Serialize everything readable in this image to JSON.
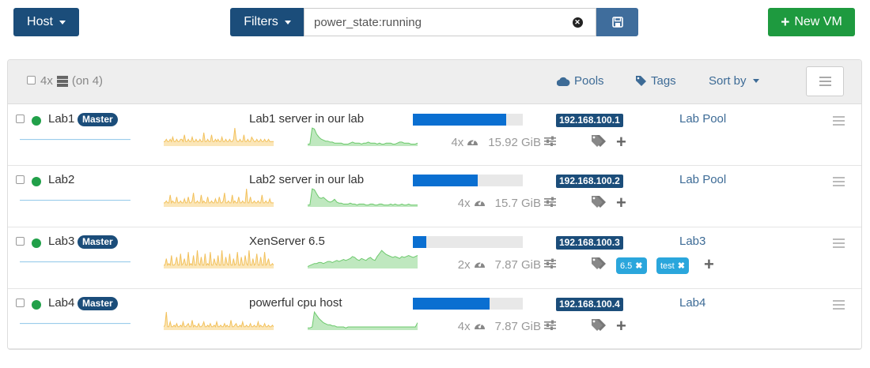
{
  "toolbar": {
    "host_label": "Host",
    "filters_label": "Filters",
    "filter_value": "power_state:running",
    "new_vm_label": "New VM"
  },
  "panel": {
    "count_label": "4x",
    "on_label": "(on 4)",
    "pools_label": "Pools",
    "tags_label": "Tags",
    "sort_label": "Sort by"
  },
  "colors": {
    "primary": "#1b4d7a",
    "success": "#1e9a3f",
    "running": "#21a049",
    "link": "#3d6b96",
    "tag": "#2aa6dc"
  },
  "hosts": [
    {
      "name": "Lab1",
      "master": "Master",
      "description": "Lab1 server in our lab",
      "usage": 0.85,
      "ip": "192.168.100.1",
      "pool": "Lab Pool",
      "cpus": "4x",
      "ram": "15.92 GiB",
      "tags": []
    },
    {
      "name": "Lab2",
      "master": "",
      "description": "Lab2 server in our lab",
      "usage": 0.59,
      "ip": "192.168.100.2",
      "pool": "Lab Pool",
      "cpus": "4x",
      "ram": "15.7 GiB",
      "tags": []
    },
    {
      "name": "Lab3",
      "master": "Master",
      "description": "XenServer 6.5",
      "usage": 0.12,
      "ip": "192.168.100.3",
      "pool": "Lab3",
      "cpus": "2x",
      "ram": "7.87 GiB",
      "tags": [
        "6.5",
        "test"
      ]
    },
    {
      "name": "Lab4",
      "master": "Master",
      "description": "powerful cpu host",
      "usage": 0.7,
      "ip": "192.168.100.4",
      "pool": "Lab4",
      "cpus": "4x",
      "ram": "7.87 GiB",
      "tags": []
    }
  ]
}
